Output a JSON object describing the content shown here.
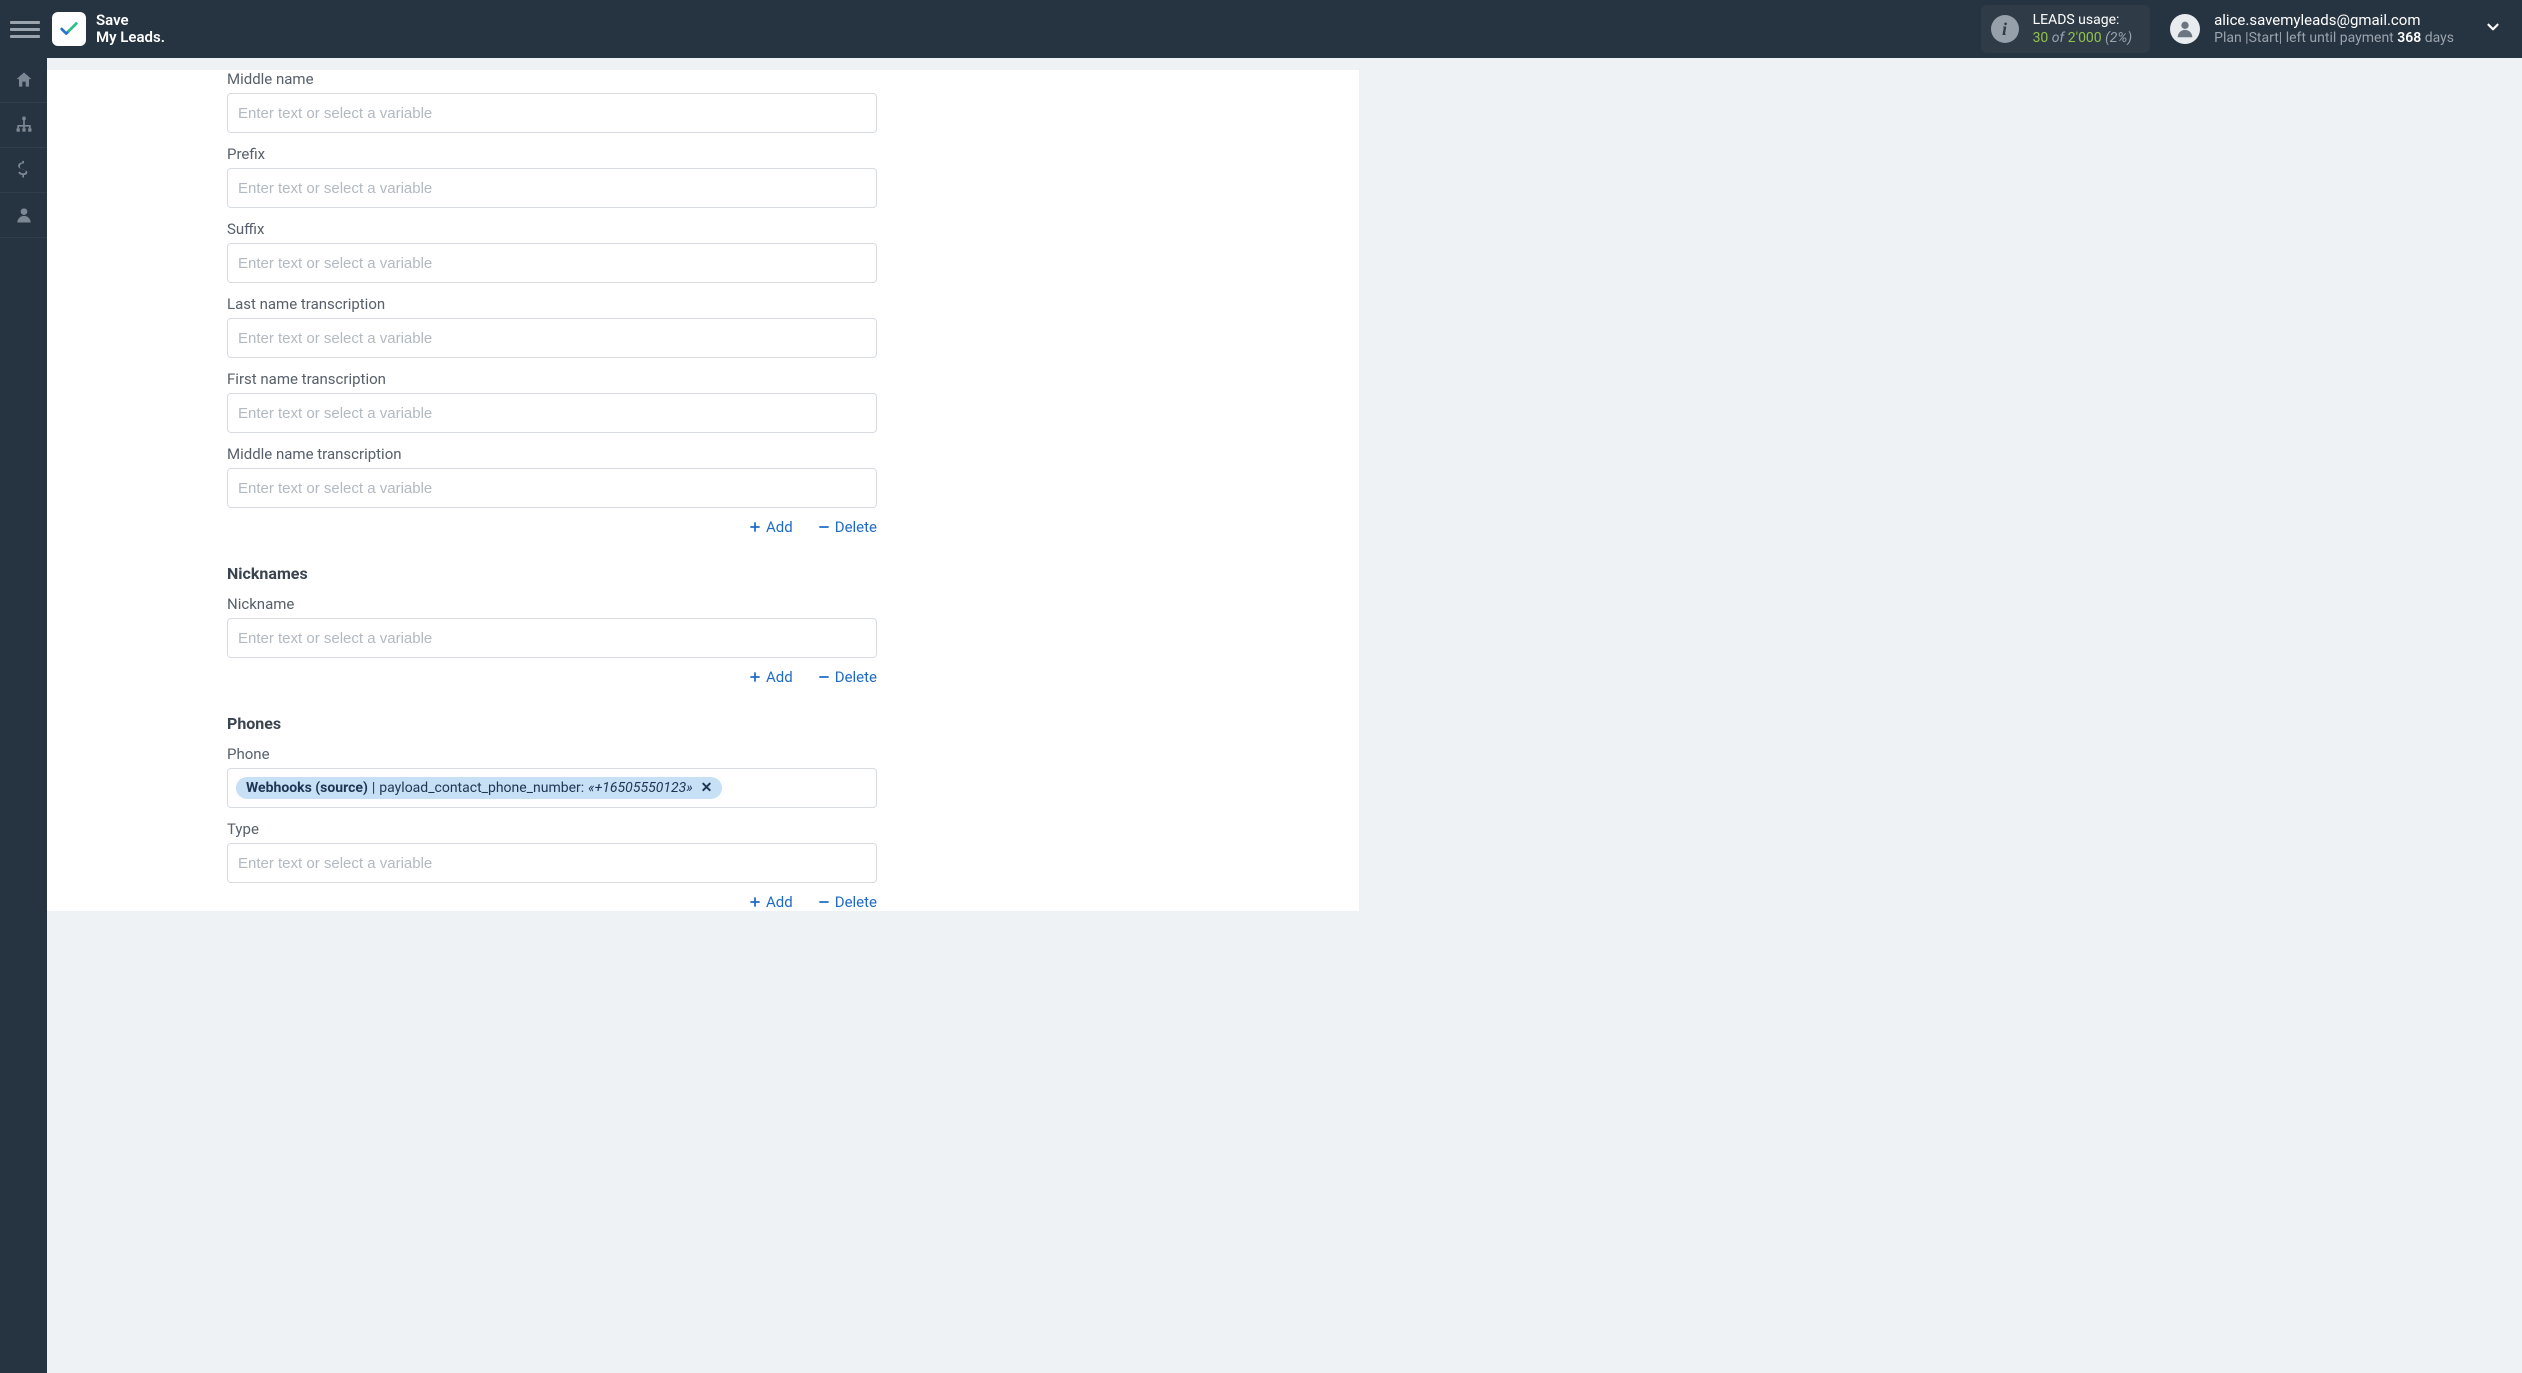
{
  "header": {
    "brand_line1": "Save",
    "brand_line2": "My Leads.",
    "usage": {
      "label": "LEADS usage:",
      "used": "30",
      "of": "of",
      "total": "2'000",
      "percent": "(2%)"
    },
    "user": {
      "email": "alice.savemyleads@gmail.com",
      "plan_prefix": "Plan |",
      "plan_name": "Start",
      "plan_mid": "| left until payment",
      "days": "368",
      "days_suffix": "days"
    }
  },
  "fields": {
    "middle_name": {
      "label": "Middle name",
      "placeholder": "Enter text or select a variable"
    },
    "prefix": {
      "label": "Prefix",
      "placeholder": "Enter text or select a variable"
    },
    "suffix": {
      "label": "Suffix",
      "placeholder": "Enter text or select a variable"
    },
    "last_name_tr": {
      "label": "Last name transcription",
      "placeholder": "Enter text or select a variable"
    },
    "first_name_tr": {
      "label": "First name transcription",
      "placeholder": "Enter text or select a variable"
    },
    "middle_name_tr": {
      "label": "Middle name transcription",
      "placeholder": "Enter text or select a variable"
    },
    "nickname": {
      "label": "Nickname",
      "placeholder": "Enter text or select a variable"
    },
    "phone": {
      "label": "Phone"
    },
    "type": {
      "label": "Type",
      "placeholder": "Enter text or select a variable"
    }
  },
  "sections": {
    "nicknames": "Nicknames",
    "phones": "Phones"
  },
  "actions": {
    "add": "Add",
    "delete": "Delete"
  },
  "phone_pill": {
    "source": "Webhooks (source)",
    "sep": " | ",
    "key": "payload_contact_phone_number: ",
    "value": "«+16505550123»"
  }
}
